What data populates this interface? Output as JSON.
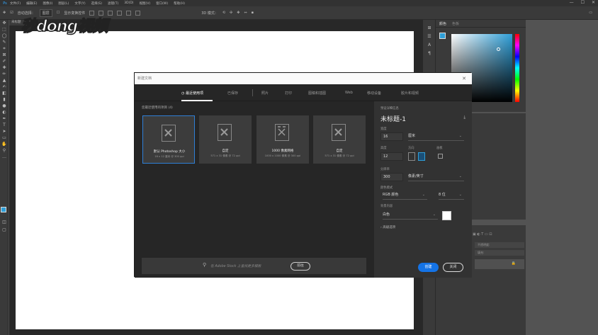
{
  "menubar": {
    "logo": "Ps",
    "items": [
      "文件(F)",
      "编辑(E)",
      "图像(I)",
      "图层(L)",
      "文字(Y)",
      "选择(S)",
      "滤镜(T)",
      "3D(D)",
      "视图(V)",
      "窗口(W)",
      "帮助(H)"
    ],
    "window_buttons": [
      "—",
      "☐",
      "✕"
    ]
  },
  "optionsbar": {
    "auto_select_label": "自动选择：",
    "auto_select_value": "图层",
    "show_transform_label": "显示变换控件",
    "mode_3d_label": "3D 模式："
  },
  "document": {
    "tab_label": "未标题"
  },
  "watermark": "秒dong视频",
  "color_panel": {
    "tabs": [
      "颜色",
      "色板"
    ],
    "fg_color": "#2f9fd8",
    "bg_color": "#ffffff"
  },
  "layers_panel": {
    "rows": [
      "不透明度:",
      "填充:"
    ]
  },
  "dialog": {
    "title": "新建文档",
    "tabs": [
      "最近使用项",
      "已保存",
      "照片",
      "打印",
      "图稿和插图",
      "Web",
      "移动设备",
      "胶片和视频"
    ],
    "recent_label": "您最近使用的项目",
    "recent_count": "(4)",
    "cards": [
      {
        "name": "默认 Photoshop 大小",
        "sub": "16 x 12 厘米 @ 300 ppi"
      },
      {
        "name": "自定",
        "sub": "571 x 31 像素 @ 72 ppi"
      },
      {
        "name": "1000 像素网格",
        "sub": "1000 x 1000 像素 @ 300 ppi"
      },
      {
        "name": "自定",
        "sub": "571 x 31 像素 @ 72 ppi"
      }
    ],
    "search_placeholder": "在 Adobe Stock 上查找更多模板",
    "go_label": "前往",
    "details": {
      "section_label": "预设详细信息",
      "name": "未标题-1",
      "width_label": "宽度",
      "width_value": "16",
      "width_unit": "厘米",
      "height_label": "高度",
      "height_value": "12",
      "orientation_label": "方向",
      "artboard_label": "画板",
      "resolution_label": "分辨率",
      "resolution_value": "300",
      "resolution_unit": "像素/英寸",
      "color_mode_label": "颜色模式",
      "color_mode_value": "RGB 颜色",
      "bit_depth": "8 位",
      "background_label": "背景内容",
      "background_value": "白色",
      "advanced_label": "高级选项",
      "create_label": "创建",
      "close_label": "关闭"
    }
  }
}
